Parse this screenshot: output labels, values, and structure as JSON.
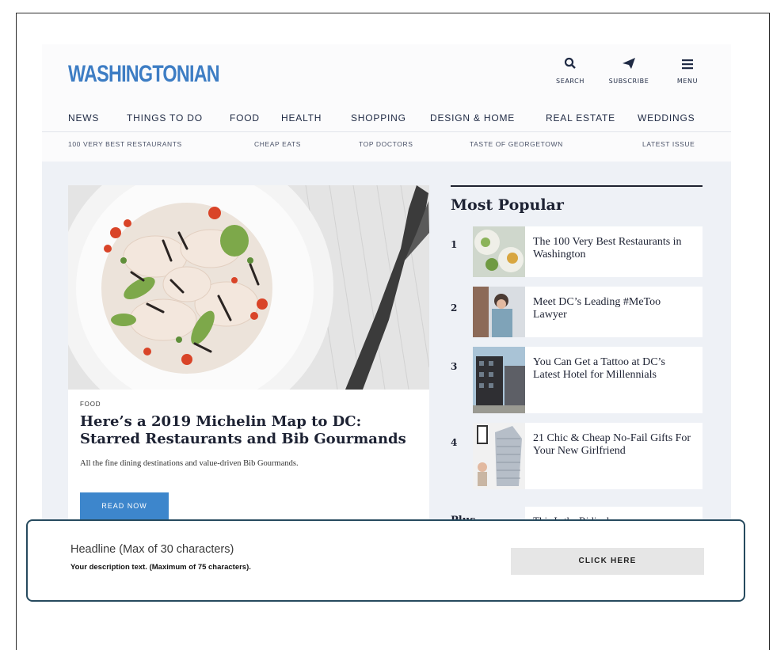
{
  "header": {
    "logo": "WASHINGTONIAN",
    "search_label": "SEARCH",
    "subscribe_label": "SUBSCRIBE",
    "menu_label": "MENU"
  },
  "nav_main": [
    "NEWS",
    "THINGS TO DO",
    "FOOD",
    "HEALTH",
    "SHOPPING",
    "DESIGN & HOME",
    "REAL ESTATE",
    "WEDDINGS"
  ],
  "nav_sub": [
    "100 VERY BEST RESTAURANTS",
    "CHEAP EATS",
    "TOP DOCTORS",
    "TASTE OF GEORGETOWN",
    "LATEST ISSUE"
  ],
  "feature": {
    "category": "FOOD",
    "title": "Here’s a 2019 Michelin Map to DC: Starred Restaurants and Bib Gourmands",
    "description": "All the fine dining destinations and value-driven Bib Gourmands.",
    "button": "READ NOW"
  },
  "most_popular": {
    "heading": "Most Popular",
    "items": [
      {
        "num": "1",
        "title": "The 100 Very Best Restaurants in Washington"
      },
      {
        "num": "2",
        "title": "Meet DC’s Leading #MeToo Lawyer"
      },
      {
        "num": "3",
        "title": "You Can Get a Tattoo at DC’s Latest Hotel for Millennials"
      },
      {
        "num": "4",
        "title": "21 Chic & Cheap No-Fail Gifts For Your New Girlfriend"
      }
    ],
    "plus_label": "Plus",
    "plus_title": "This Is the Ridiculous"
  },
  "ad": {
    "headline": "Headline (Max of 30 characters)",
    "description": "Your description text. (Maximum of 75 characters).",
    "button": "CLICK HERE"
  },
  "colors": {
    "brand": "#3d7dc4",
    "button_blue": "#3d86cc",
    "overlay_border": "#264a5e"
  }
}
